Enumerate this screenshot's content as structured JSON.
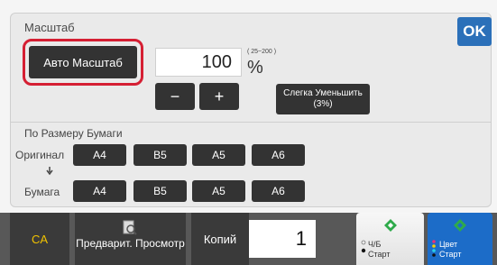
{
  "header": {
    "title": "Масштаб",
    "ok_label": "OK"
  },
  "zoom": {
    "auto_label": "Авто Масштаб",
    "value": "100",
    "range": "( 25~200 )",
    "unit": "%",
    "minus_label": "−",
    "plus_label": "+",
    "slight_reduce_label": "Слегка Уменьшить (3%)"
  },
  "paper": {
    "section_title": "По Размеру Бумаги",
    "original_label": "Оригинал",
    "output_label": "Бумага",
    "original_sizes": [
      "A4",
      "B5",
      "A5",
      "A6"
    ],
    "output_sizes": [
      "A4",
      "B5",
      "A5",
      "A6"
    ]
  },
  "bottom": {
    "ca_label": "CA",
    "preview_label": "Предварит. Просмотр",
    "copies_label": "Копий",
    "copies_value": "1",
    "start_bw_mode": "Ч/Б",
    "start_bw_label": "Старт",
    "start_color_mode": "Цвет",
    "start_color_label": "Старт"
  },
  "colors": {
    "accent_blue": "#2b70b9",
    "highlight_red": "#d51f33",
    "ca_yellow": "#f2c300",
    "start_green": "#2eaa4a"
  }
}
